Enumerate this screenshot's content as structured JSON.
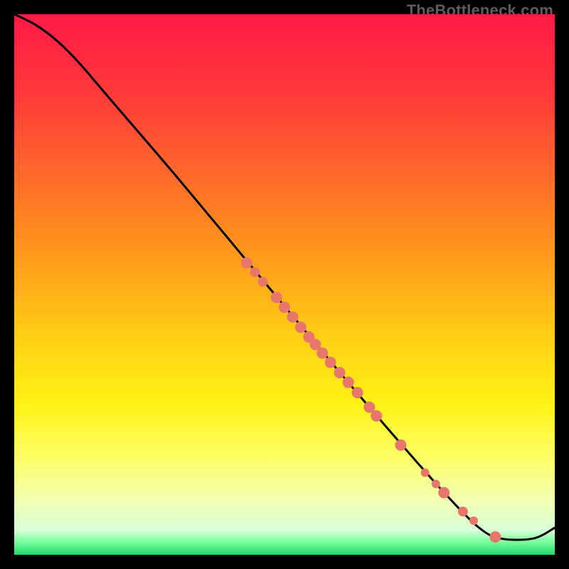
{
  "watermark": "TheBottleneck.com",
  "colors": {
    "dot_fill": "#e8766d",
    "curve_stroke": "#000000",
    "gradient_stops": [
      {
        "offset": 0.0,
        "color": "#ff1a46"
      },
      {
        "offset": 0.15,
        "color": "#ff3a3a"
      },
      {
        "offset": 0.3,
        "color": "#ff6a2a"
      },
      {
        "offset": 0.45,
        "color": "#ff9a1a"
      },
      {
        "offset": 0.6,
        "color": "#ffd015"
      },
      {
        "offset": 0.72,
        "color": "#fff215"
      },
      {
        "offset": 0.82,
        "color": "#fdff66"
      },
      {
        "offset": 0.9,
        "color": "#f2ffb3"
      },
      {
        "offset": 0.955,
        "color": "#d8ffd8"
      },
      {
        "offset": 0.975,
        "color": "#7fff9f"
      },
      {
        "offset": 1.0,
        "color": "#1fd96b"
      }
    ]
  },
  "chart_data": {
    "type": "line",
    "title": "",
    "xlabel": "",
    "ylabel": "",
    "xlim": [
      0,
      100
    ],
    "ylim": [
      0,
      100
    ],
    "grid": false,
    "legend": false,
    "curve": [
      {
        "x": 0,
        "y": 100
      },
      {
        "x": 4,
        "y": 98
      },
      {
        "x": 8,
        "y": 95
      },
      {
        "x": 12,
        "y": 91
      },
      {
        "x": 18,
        "y": 84
      },
      {
        "x": 30,
        "y": 70
      },
      {
        "x": 45,
        "y": 52
      },
      {
        "x": 60,
        "y": 34
      },
      {
        "x": 72,
        "y": 20
      },
      {
        "x": 80,
        "y": 11
      },
      {
        "x": 86,
        "y": 5
      },
      {
        "x": 90,
        "y": 3
      },
      {
        "x": 96,
        "y": 3
      },
      {
        "x": 100,
        "y": 5
      }
    ],
    "points": [
      {
        "x": 43,
        "y": 54,
        "r": 8
      },
      {
        "x": 44.5,
        "y": 52.3,
        "r": 7
      },
      {
        "x": 46,
        "y": 50.5,
        "r": 7
      },
      {
        "x": 48.5,
        "y": 47.6,
        "r": 8
      },
      {
        "x": 50,
        "y": 45.8,
        "r": 8
      },
      {
        "x": 51.5,
        "y": 44.0,
        "r": 8
      },
      {
        "x": 53,
        "y": 42.1,
        "r": 8
      },
      {
        "x": 54.5,
        "y": 40.3,
        "r": 8
      },
      {
        "x": 55.7,
        "y": 38.9,
        "r": 8
      },
      {
        "x": 57,
        "y": 37.3,
        "r": 8
      },
      {
        "x": 58.5,
        "y": 35.6,
        "r": 8
      },
      {
        "x": 60.2,
        "y": 33.7,
        "r": 8
      },
      {
        "x": 61.8,
        "y": 31.9,
        "r": 8
      },
      {
        "x": 63.5,
        "y": 30.0,
        "r": 8
      },
      {
        "x": 65.7,
        "y": 27.3,
        "r": 8
      },
      {
        "x": 67,
        "y": 25.7,
        "r": 8
      },
      {
        "x": 71.5,
        "y": 20.3,
        "r": 8
      },
      {
        "x": 76,
        "y": 15.2,
        "r": 6
      },
      {
        "x": 78,
        "y": 13.1,
        "r": 6
      },
      {
        "x": 79.5,
        "y": 11.5,
        "r": 8
      },
      {
        "x": 83,
        "y": 8.0,
        "r": 7
      },
      {
        "x": 85,
        "y": 6.3,
        "r": 6
      },
      {
        "x": 89,
        "y": 3.3,
        "r": 8
      }
    ]
  }
}
